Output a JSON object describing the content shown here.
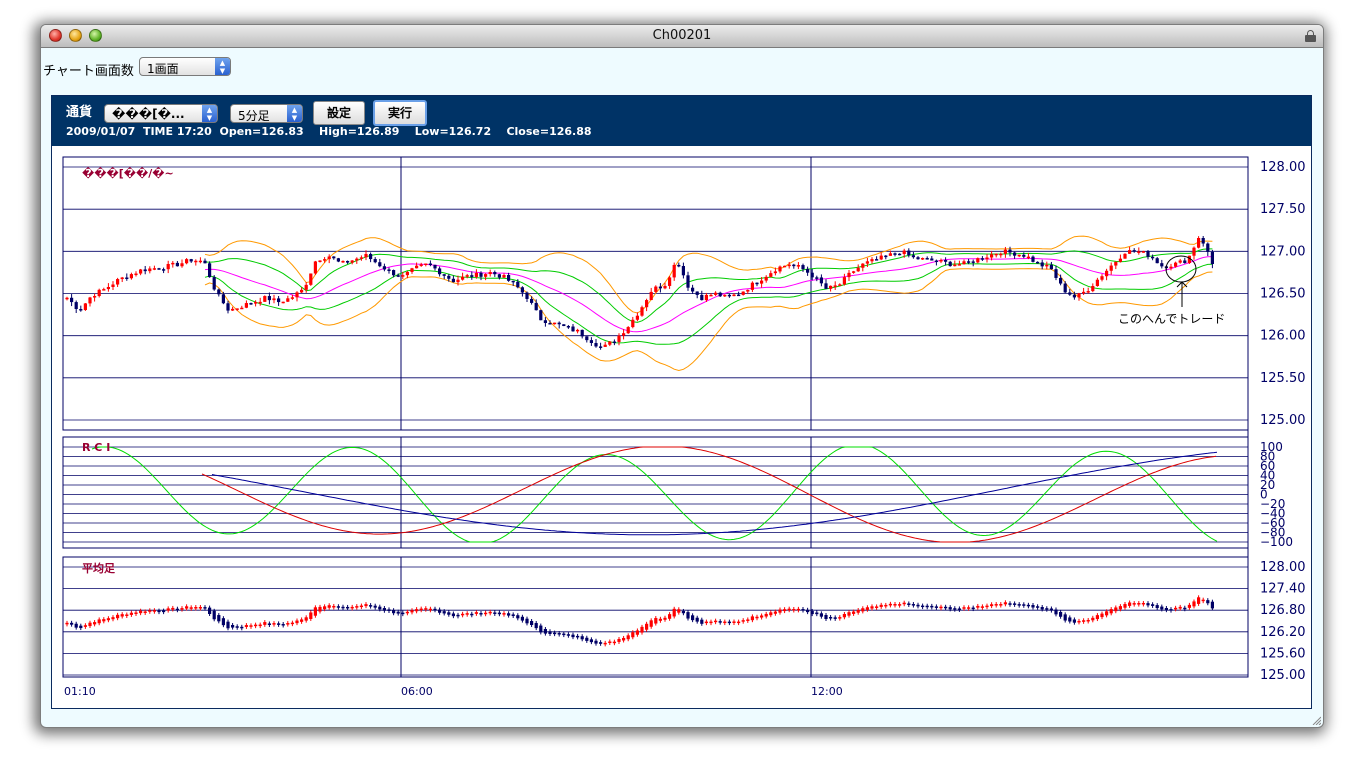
{
  "window": {
    "title": "Ch00201"
  },
  "toolbar": {
    "screens_label": "チャート画面数",
    "screens_value": "1画面"
  },
  "controls": {
    "currency_label": "通貨",
    "currency_value": "���[�...",
    "interval_value": "5分足",
    "settings_button": "設定",
    "run_button": "実行"
  },
  "info": {
    "date": "2009/01/07",
    "time": "TIME 17:20",
    "open": "Open=126.83",
    "high": "High=126.89",
    "low": "Low=126.72",
    "close": "Close=126.88"
  },
  "colors": {
    "header_bg": "#003366",
    "up": "#ff0000",
    "down": "#000066"
  },
  "chart_data": [
    {
      "type": "candlestick",
      "title": "���[��/�~",
      "y_ticks": [
        "128.00",
        "127.50",
        "127.00",
        "126.50",
        "126.00",
        "125.50",
        "125.00"
      ],
      "ylim": [
        125.0,
        128.0
      ],
      "x_ticks": [
        "01:10",
        "06:00",
        "12:00"
      ],
      "close_path": [
        126.45,
        126.3,
        126.48,
        126.55,
        126.65,
        126.72,
        126.78,
        126.8,
        126.82,
        126.85,
        126.9,
        126.88,
        126.5,
        126.3,
        126.35,
        126.4,
        126.45,
        126.4,
        126.45,
        126.55,
        126.9,
        126.95,
        126.85,
        126.9,
        126.95,
        126.85,
        126.75,
        126.7,
        126.8,
        126.85,
        126.75,
        126.65,
        126.7,
        126.72,
        126.75,
        126.7,
        126.6,
        126.45,
        126.2,
        126.15,
        126.1,
        126.05,
        125.95,
        125.85,
        125.95,
        126.1,
        126.3,
        126.55,
        126.6,
        126.9,
        126.55,
        126.45,
        126.5,
        126.45,
        126.5,
        126.6,
        126.7,
        126.8,
        126.85,
        126.8,
        126.7,
        126.55,
        126.6,
        126.75,
        126.85,
        126.9,
        126.95,
        127.0,
        126.92,
        126.9,
        126.88,
        126.85,
        126.85,
        126.9,
        126.95,
        127.0,
        126.98,
        126.95,
        126.85,
        126.8,
        126.55,
        126.45,
        126.55,
        126.7,
        126.85,
        127.0,
        127.0,
        126.95,
        126.82,
        126.85,
        126.9,
        127.2,
        126.85
      ],
      "annotation": "このへんでトレード",
      "bollinger": "upper/lower bands (orange, green) with moving average (magenta)"
    },
    {
      "type": "line",
      "title": "R C I",
      "y_ticks": [
        "100",
        "80",
        "60",
        "40",
        "20",
        "0",
        "−20",
        "−40",
        "−60",
        "−80",
        "−100"
      ],
      "ylim": [
        -100,
        100
      ],
      "series_colors": [
        "#00dd00",
        "#dd0000",
        "#000099"
      ]
    },
    {
      "type": "candlestick",
      "title": "平均足",
      "y_ticks": [
        "128.00",
        "127.40",
        "126.80",
        "126.20",
        "125.60",
        "125.00"
      ],
      "ylim": [
        125.0,
        128.0
      ]
    }
  ]
}
